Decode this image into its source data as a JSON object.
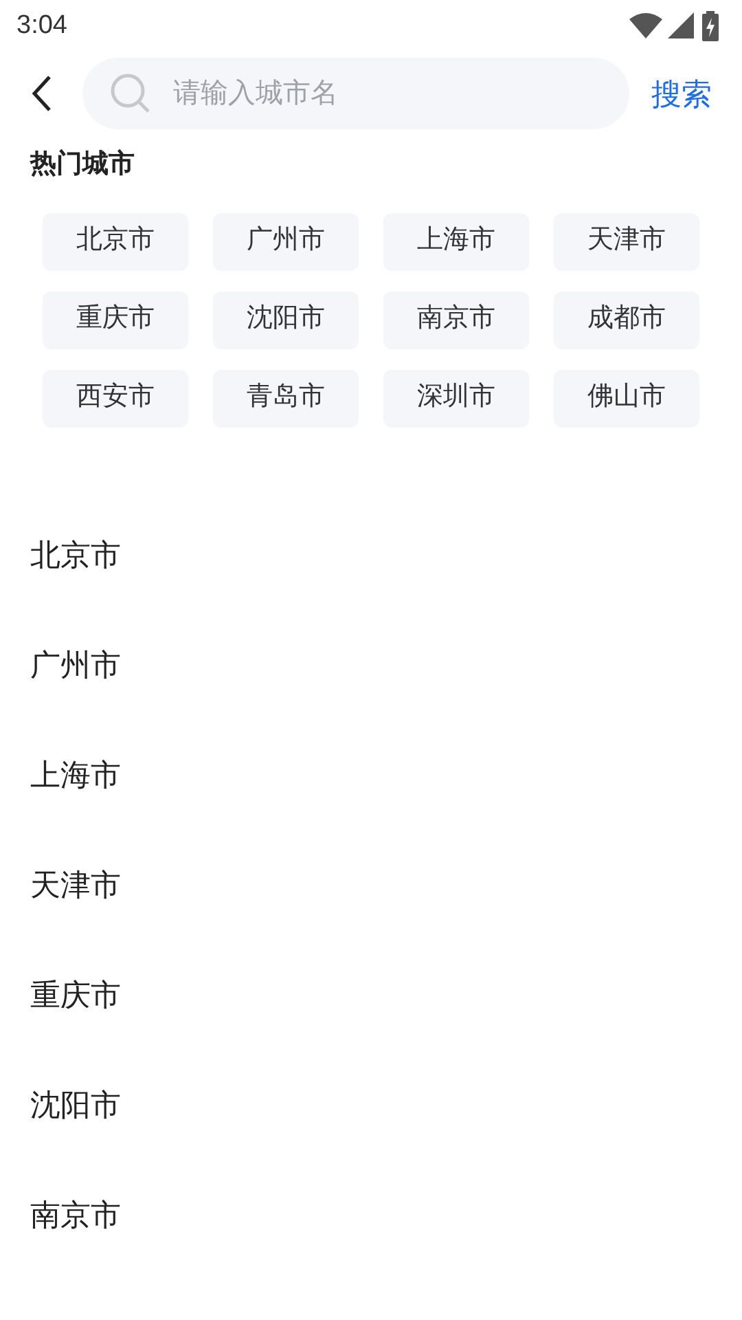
{
  "status_bar": {
    "time": "3:04"
  },
  "search": {
    "placeholder": "请输入城市名",
    "button": "搜索"
  },
  "hot_cities": {
    "title": "热门城市",
    "items": [
      "北京市",
      "广州市",
      "上海市",
      "天津市",
      "重庆市",
      "沈阳市",
      "南京市",
      "成都市",
      "西安市",
      "青岛市",
      "深圳市",
      "佛山市"
    ]
  },
  "city_list": [
    "北京市",
    "广州市",
    "上海市",
    "天津市",
    "重庆市",
    "沈阳市",
    "南京市"
  ]
}
